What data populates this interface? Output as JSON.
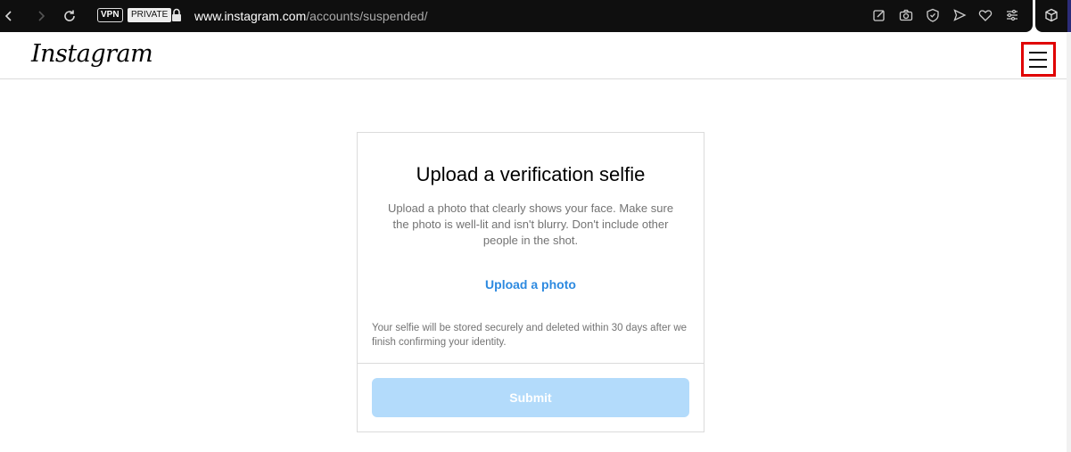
{
  "browser": {
    "vpn_label": "VPN",
    "private_label": "PRIVATE",
    "url_host": "www.instagram.com",
    "url_path": "/accounts/suspended/"
  },
  "header": {
    "logo_text": "Instagram",
    "menu_icon": "hamburger-menu-icon"
  },
  "card": {
    "title": "Upload a verification selfie",
    "description": "Upload a photo that clearly shows your face. Make sure the photo is well-lit and isn't blurry. Don't include other people in the shot.",
    "upload_link": "Upload a photo",
    "storage_note": "Your selfie will be stored securely and deleted within 30 days after we finish confirming your identity.",
    "submit_label": "Submit"
  },
  "colors": {
    "link": "#2d8ae0",
    "submit_disabled": "#b3dbfb",
    "highlight": "#e00000"
  }
}
